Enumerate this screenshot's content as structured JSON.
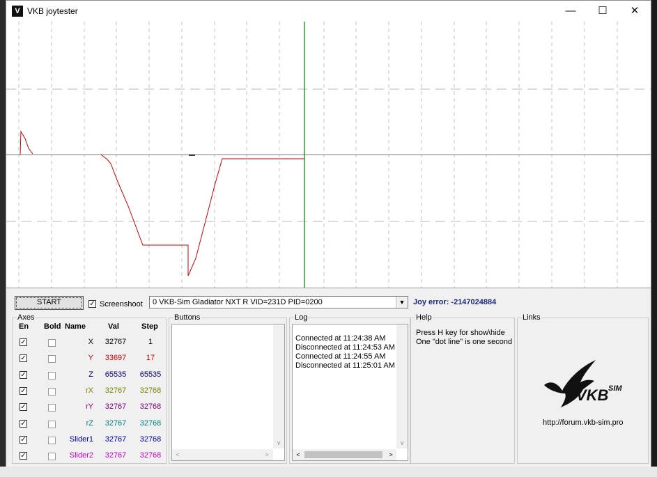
{
  "window": {
    "title": "VKB joytester",
    "icon": "vkb-logo-icon"
  },
  "controls": {
    "start_label": "START",
    "screenshot_label": "Screenshoot",
    "screenshot_checked": true,
    "device_selected": "0  VKB-Sim Gladiator NXT R   VID=231D PID=0200",
    "joy_error": "Joy error: -2147024884"
  },
  "axes": {
    "title": "Axes",
    "headers": {
      "en": "En",
      "bold": "Bold",
      "name": "Name",
      "val": "Val",
      "step": "Step"
    },
    "rows": [
      {
        "name": "X",
        "val": "32767",
        "step": "1",
        "color": "#000000",
        "en": true,
        "bold": false
      },
      {
        "name": "Y",
        "val": "33697",
        "step": "17",
        "color": "#cc0000",
        "en": true,
        "bold": false
      },
      {
        "name": "Z",
        "val": "65535",
        "step": "65535",
        "color": "#000080",
        "en": true,
        "bold": false
      },
      {
        "name": "rX",
        "val": "32767",
        "step": "32768",
        "color": "#808000",
        "en": true,
        "bold": false
      },
      {
        "name": "rY",
        "val": "32767",
        "step": "32768",
        "color": "#800080",
        "en": true,
        "bold": false
      },
      {
        "name": "rZ",
        "val": "32767",
        "step": "32768",
        "color": "#008080",
        "en": true,
        "bold": false
      },
      {
        "name": "Slider1",
        "val": "32767",
        "step": "32768",
        "color": "#0000aa",
        "en": true,
        "bold": false
      },
      {
        "name": "Slider2",
        "val": "32767",
        "step": "32768",
        "color": "#cc00cc",
        "en": true,
        "bold": false
      }
    ]
  },
  "buttons_panel": {
    "title": "Buttons"
  },
  "log": {
    "title": "Log",
    "lines": [
      "Connected at 11:24:38 AM",
      "Disconnected at 11:24:53 AM",
      "Connected at 11:24:55 AM",
      "Disconnected at 11:25:01 AM"
    ]
  },
  "help": {
    "title": "Help",
    "lines": [
      "Press H key for show\\hide",
      "One \"dot line\" is one second"
    ]
  },
  "links": {
    "title": "Links",
    "logo_text": "VKB SIM",
    "url": "http://forum.vkb-sim.pro"
  },
  "colors": {
    "plot_trace": "#cc0000",
    "cursor_line": "#008000",
    "joy_error": "#1a2a7a"
  }
}
